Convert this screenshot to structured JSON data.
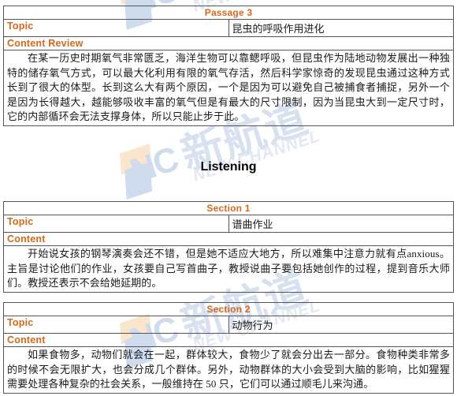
{
  "document": {
    "watermark": {
      "logo_text": "NC",
      "brand_cn": "新航道",
      "brand_en": "NEW CHANNEL",
      "logo_color": "#cfdcee",
      "accent_color": "#fae6cd"
    },
    "accent_color": "#d2691e",
    "border_color": "#555555"
  },
  "headings": {
    "listening": "Listening"
  },
  "labels": {
    "topic": "Topic",
    "content_review": "Content Review",
    "content": "Content"
  },
  "tables": [
    {
      "title": "Passage 3",
      "topic_label": "Topic",
      "topic_value": "昆虫的呼吸作用进化",
      "content_label": "Content Review",
      "content_text": "在某一历史时期氧气非常匮乏，海洋生物可以靠鳃呼吸，但昆虫作为陆地动物发展出一种独特的储存氧气方式，可以最大化利用有限的氧气存活，然后科学家惊奇的发现昆虫通过这种方式长到了很大的体型。长到这么大有两个原因，一个是因为可以避免自己被捕食者捕捉，另外一个是因为长得越大，越能够吸收丰富的氧气但是有最大的尺寸限制，因为当昆虫大到一定尺寸时，它的内部循环会无法支撑身体，所以只能止步于此。"
    },
    {
      "title": "Section 1",
      "topic_label": "Topic",
      "topic_value": "谱曲作业",
      "content_label": "Content",
      "content_text": "开始说女孩的钢琴演奏会还不错，但是她不适应大地方，所以难集中注意力就有点anxious。主旨是讨论他们的作业，女孩要自己写首曲子，教授说曲子要包括她创作的过程，提到音乐大师们。教授还表示不会给她延期的。"
    },
    {
      "title": "Section 2",
      "topic_label": "Topic",
      "topic_value": "动物行为",
      "content_label": "Content",
      "content_text": "如果食物多，动物们就会在一起，群体较大，食物少了就会分出去一部分。食物种类非常多的时候不会无限扩大，也会分成几个群体。另外，动物群体的大小会受到大脑的影响，比如猩猩需要处理各种复杂的社会关系，一般维持在 50 只，它们可以通过顺毛儿来沟通。"
    }
  ]
}
